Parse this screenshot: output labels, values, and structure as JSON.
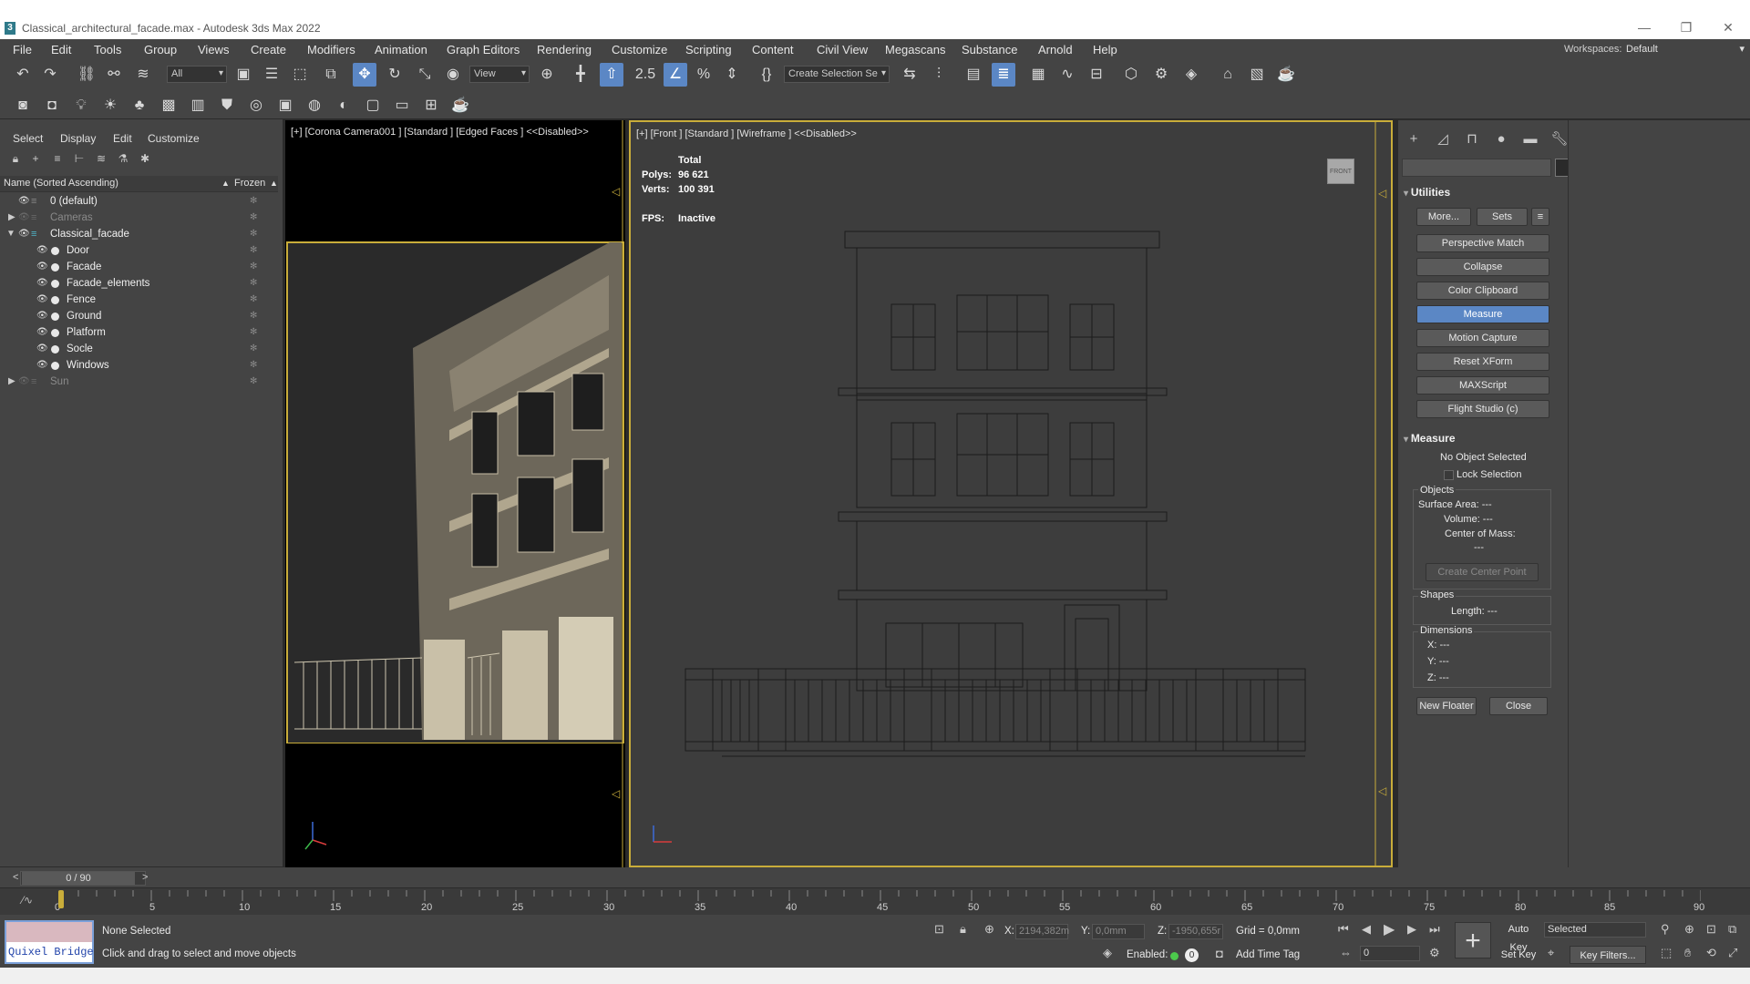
{
  "window": {
    "title": "Classical_architectural_facade.max - Autodesk 3ds Max 2022"
  },
  "menu": [
    "File",
    "Edit",
    "Tools",
    "Group",
    "Views",
    "Create",
    "Modifiers",
    "Animation",
    "Graph Editors",
    "Rendering",
    "Customize",
    "Scripting",
    "Content",
    "Civil View",
    "Megascans",
    "Substance",
    "Arnold",
    "Help"
  ],
  "workspaces": {
    "label": "Workspaces:",
    "value": "Default"
  },
  "toolbar": {
    "selection_filter": "All",
    "ref_coord": "View",
    "named_selection": "Create Selection Se",
    "snap_label": "2.5"
  },
  "explorer": {
    "menu": [
      "Select",
      "Display",
      "Edit",
      "Customize"
    ],
    "header_name": "Name (Sorted Ascending)",
    "header_frozen": "Frozen",
    "rows": [
      "0 (default)",
      "Cameras",
      "Classical_facade",
      "Door",
      "Facade",
      "Facade_elements",
      "Fence",
      "Ground",
      "Platform",
      "Socle",
      "Windows",
      "Sun"
    ]
  },
  "viewports": {
    "camera_label": "[+] [Corona Camera001 ] [Standard ] [Edged Faces ]  <<Disabled>>",
    "front_label": "[+] [Front ] [Standard ] [Wireframe ]  <<Disabled>>",
    "stats": {
      "total": "Total",
      "polys_label": "Polys:",
      "polys_value": "96 621",
      "verts_label": "Verts:",
      "verts_value": "100 391",
      "fps_label": "FPS:",
      "fps_value": "Inactive"
    },
    "viewcube": "FRONT"
  },
  "command_panel": {
    "utilities_title": "Utilities",
    "more": "More...",
    "sets": "Sets",
    "utility_buttons": [
      "Perspective Match",
      "Collapse",
      "Color Clipboard",
      "Measure",
      "Motion Capture",
      "Reset XForm",
      "MAXScript",
      "Flight Studio (c)"
    ],
    "measure_title": "Measure",
    "no_object": "No Object Selected",
    "lock_selection": "Lock Selection",
    "objects_group": "Objects",
    "surface_area": "Surface Area: ---",
    "volume": "Volume: ---",
    "center_of_mass": "Center of Mass:",
    "center_value": "---",
    "create_center": "Create Center Point",
    "shapes_group": "Shapes",
    "length": "Length: ---",
    "dimensions_group": "Dimensions",
    "dim_x": "X:  ---",
    "dim_y": "Y:  ---",
    "dim_z": "Z:  ---",
    "new_floater": "New Floater",
    "close": "Close"
  },
  "timeline": {
    "frame": "0 / 90",
    "ticks": [
      "0",
      "5",
      "10",
      "15",
      "20",
      "25",
      "30",
      "35",
      "40",
      "45",
      "50",
      "55",
      "60",
      "65",
      "70",
      "75",
      "80",
      "85",
      "90"
    ]
  },
  "status": {
    "quixel": "Quixel Bridge",
    "selection": "None Selected",
    "prompt": "Click and drag to select and move objects",
    "x_label": "X:",
    "x_value": "2194,382m",
    "y_label": "Y:",
    "y_value": "0,0mm",
    "z_label": "Z:",
    "z_value": "-1950,655r",
    "grid": "Grid = 0,0mm",
    "enabled": "Enabled:",
    "add_time_tag": "Add Time Tag",
    "frame_value": "0",
    "auto_key": "Auto Key",
    "set_key": "Set Key",
    "selected": "Selected",
    "key_filters": "Key Filters..."
  },
  "colors": {
    "accent": "#5b87c5",
    "viewport_border": "#c9ad3a",
    "panel_bg": "#444444"
  }
}
